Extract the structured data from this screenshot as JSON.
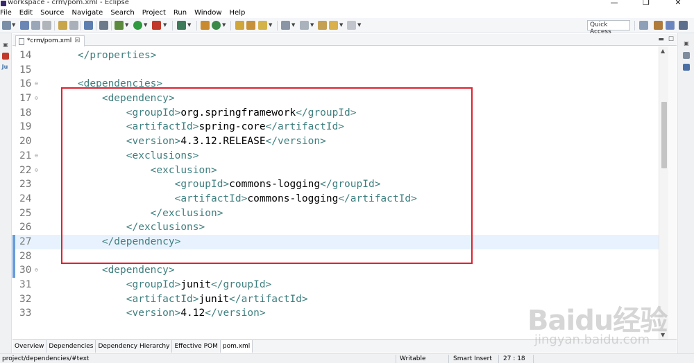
{
  "window": {
    "title": "workspace - crm/pom.xml - Eclipse",
    "controls": [
      "—",
      "❐",
      "✕"
    ]
  },
  "menu": [
    "File",
    "Edit",
    "Source",
    "Navigate",
    "Search",
    "Project",
    "Run",
    "Window",
    "Help"
  ],
  "toolbar": {
    "quick_access": "Quick Access"
  },
  "editor_tab": {
    "label": "*crm/pom.xml",
    "close": "☒"
  },
  "editor": {
    "lines": [
      {
        "num": "14",
        "fold": "",
        "parts": [
          {
            "t": "tag",
            "v": "    </properties>"
          }
        ]
      },
      {
        "num": "15",
        "fold": "",
        "parts": []
      },
      {
        "num": "16",
        "fold": "⊖",
        "parts": [
          {
            "t": "tag",
            "v": "    <dependencies>"
          }
        ]
      },
      {
        "num": "17",
        "fold": "⊖",
        "parts": [
          {
            "t": "tag",
            "v": "        <dependency>"
          }
        ]
      },
      {
        "num": "18",
        "fold": "",
        "parts": [
          {
            "t": "tag",
            "v": "            <groupId>"
          },
          {
            "t": "txt",
            "v": "org.springframework"
          },
          {
            "t": "tag",
            "v": "</groupId>"
          }
        ]
      },
      {
        "num": "19",
        "fold": "",
        "parts": [
          {
            "t": "tag",
            "v": "            <artifactId>"
          },
          {
            "t": "txt",
            "v": "spring-core"
          },
          {
            "t": "tag",
            "v": "</artifactId>"
          }
        ]
      },
      {
        "num": "20",
        "fold": "",
        "parts": [
          {
            "t": "tag",
            "v": "            <version>"
          },
          {
            "t": "txt",
            "v": "4.3.12.RELEASE"
          },
          {
            "t": "tag",
            "v": "</version>"
          }
        ]
      },
      {
        "num": "21",
        "fold": "⊖",
        "parts": [
          {
            "t": "tag",
            "v": "            <exclusions>"
          }
        ]
      },
      {
        "num": "22",
        "fold": "⊖",
        "parts": [
          {
            "t": "tag",
            "v": "                <exclusion>"
          }
        ]
      },
      {
        "num": "23",
        "fold": "",
        "parts": [
          {
            "t": "tag",
            "v": "                    <groupId>"
          },
          {
            "t": "txt",
            "v": "commons-logging"
          },
          {
            "t": "tag",
            "v": "</groupId>"
          }
        ]
      },
      {
        "num": "24",
        "fold": "",
        "parts": [
          {
            "t": "tag",
            "v": "                    <artifactId>"
          },
          {
            "t": "txt",
            "v": "commons-logging"
          },
          {
            "t": "tag",
            "v": "</artifactId>"
          }
        ]
      },
      {
        "num": "25",
        "fold": "",
        "parts": [
          {
            "t": "tag",
            "v": "                </exclusion>"
          }
        ]
      },
      {
        "num": "26",
        "fold": "",
        "parts": [
          {
            "t": "tag",
            "v": "            </exclusions>"
          }
        ]
      },
      {
        "num": "27",
        "fold": "",
        "current": true,
        "changed": true,
        "parts": [
          {
            "t": "tag",
            "v": "        </dependency>"
          }
        ]
      },
      {
        "num": "28",
        "fold": "",
        "changed": true,
        "parts": []
      },
      {
        "num": "30",
        "fold": "⊖",
        "changed": true,
        "parts": [
          {
            "t": "tag",
            "v": "        <dependency>"
          }
        ]
      },
      {
        "num": "31",
        "fold": "",
        "parts": [
          {
            "t": "tag",
            "v": "            <groupId>"
          },
          {
            "t": "txt",
            "v": "junit"
          },
          {
            "t": "tag",
            "v": "</groupId>"
          }
        ]
      },
      {
        "num": "32",
        "fold": "",
        "parts": [
          {
            "t": "tag",
            "v": "            <artifactId>"
          },
          {
            "t": "txt",
            "v": "junit"
          },
          {
            "t": "tag",
            "v": "</artifactId>"
          }
        ]
      },
      {
        "num": "33",
        "fold": "",
        "parts": [
          {
            "t": "tag",
            "v": "            <version>"
          },
          {
            "t": "txt",
            "v": "4.12"
          },
          {
            "t": "tag",
            "v": "</version>"
          }
        ]
      }
    ]
  },
  "bottom_tabs": [
    "Overview",
    "Dependencies",
    "Dependency Hierarchy",
    "Effective POM",
    "pom.xml"
  ],
  "bottom_tabs_active": "pom.xml",
  "status": {
    "path": "project/dependencies/#text",
    "mode": "Writable",
    "insert": "Smart Insert",
    "position": "27 : 18"
  },
  "watermark": {
    "brand": "Baidu经验",
    "site": "jingyan.baidu.com"
  }
}
